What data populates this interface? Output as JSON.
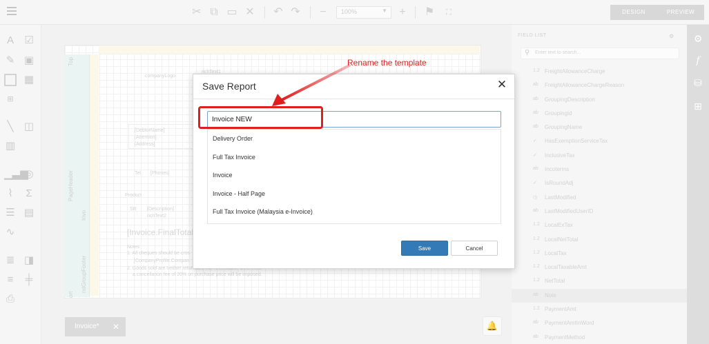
{
  "toolbar": {
    "zoom": "100%",
    "design_label": "DESIGN",
    "preview_label": "PREVIEW"
  },
  "surface": {
    "band_top": "Top",
    "band_page_header": "PageHeader",
    "band_detail": "Invo",
    "band_group_footer": "ndGroupFooter",
    "band_report_footer": "ort",
    "company_logo": "companyLogo",
    "rich_text_1": "richText1",
    "debtor_name": "[DebtorName]",
    "attention": "[Attention]",
    "address": "[Address]",
    "tel_label": "Tel",
    "phones": "[Phones]",
    "product": "Product",
    "description": "[Description]",
    "rich_text_2": "richText2",
    "final_total": "[Invoice.FinalTotalInWo",
    "notes_title": "Notes",
    "note_1": "1. All cheques should be cros",
    "company_profile": "[CompanyProfile.Compan",
    "note_2": "2. Goods sold are neither returnable nor refundable. Otherwise",
    "note_2b": "a cancellation fee of 20% on purchase price will be imposed."
  },
  "tab": {
    "label": "Invoice*"
  },
  "field_list": {
    "title": "FIELD LIST",
    "search_placeholder": "Enter text to search...",
    "items": [
      {
        "prefix": "1.2",
        "name": "FreightAllowanceCharge"
      },
      {
        "prefix": "ab",
        "name": "FreightAllowanceChargeReason"
      },
      {
        "prefix": "ab",
        "name": "GroupingDescription"
      },
      {
        "prefix": "ab",
        "name": "GroupingId"
      },
      {
        "prefix": "ab",
        "name": "GroupingName"
      },
      {
        "prefix": "✓",
        "name": "HasExemptionServiceTax"
      },
      {
        "prefix": "✓",
        "name": "InclusiveTax"
      },
      {
        "prefix": "ab",
        "name": "Incoterms"
      },
      {
        "prefix": "✓",
        "name": "IsRoundAdj"
      },
      {
        "prefix": "◷",
        "name": "LastModified"
      },
      {
        "prefix": "ab",
        "name": "LastModifiedUserID"
      },
      {
        "prefix": "1.2",
        "name": "LocalExTax"
      },
      {
        "prefix": "1.2",
        "name": "LocalNetTotal"
      },
      {
        "prefix": "1.2",
        "name": "LocalTax"
      },
      {
        "prefix": "1.2",
        "name": "LocalTaxableAmt"
      },
      {
        "prefix": "1.2",
        "name": "NetTotal"
      },
      {
        "prefix": "ab",
        "name": "Note"
      },
      {
        "prefix": "1.2",
        "name": "PaymentAmt"
      },
      {
        "prefix": "ab",
        "name": "PaymentAmtInWord"
      },
      {
        "prefix": "ab",
        "name": "PaymentMethod"
      }
    ]
  },
  "dialog": {
    "title": "Save Report",
    "name_value": "Invoice NEW",
    "templates": [
      "Delivery Order",
      "Full Tax Invoice",
      "Invoice",
      "Invoice - Half Page",
      "Full Tax Invoice (Malaysia e-Invoice)"
    ],
    "save_label": "Save",
    "cancel_label": "Cancel"
  },
  "annotation": {
    "text": "Rename the template",
    "color": "#e01e1e"
  },
  "colors": {
    "primary": "#337ab7",
    "rail": "#d6d6d6"
  }
}
